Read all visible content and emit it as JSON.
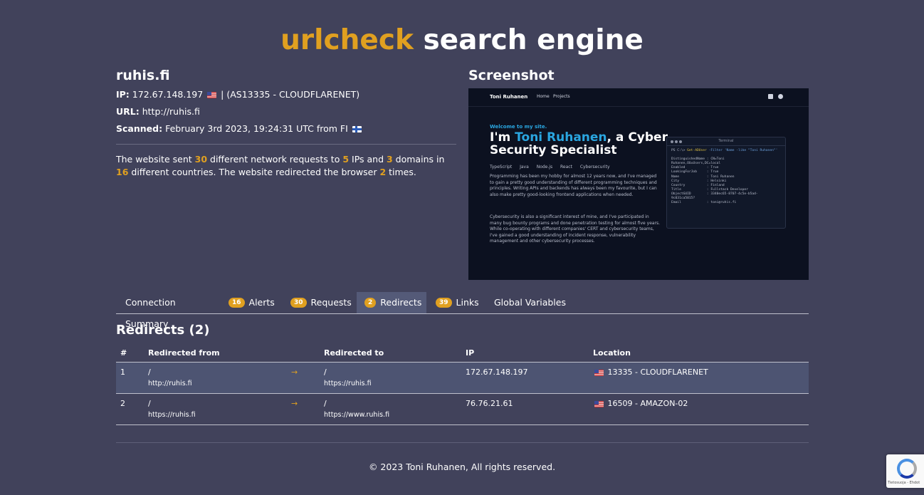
{
  "header": {
    "brand": "urlcheck",
    "rest": "search engine"
  },
  "site": {
    "domain": "ruhis.fi",
    "ip_label": "IP:",
    "ip": "172.67.148.197",
    "asn": "| (AS13335 - CLOUDFLARENET)",
    "url_label": "URL:",
    "url": "http://ruhis.fi",
    "scanned_label": "Scanned:",
    "scanned": "February 3rd 2023, 19:24:31 UTC from FI"
  },
  "summary": {
    "t1": "The website sent ",
    "requests": "30",
    "t2": " different network requests to ",
    "ips": "5",
    "t3": " IPs and ",
    "domains": "3",
    "t4": " domains in ",
    "countries": "16",
    "t5": " different countries. The website redirected the browser ",
    "redirects": "2",
    "t6": " times."
  },
  "screenshot": {
    "title": "Screenshot",
    "nav_name": "Toni Ruhanen",
    "nav_home": "Home",
    "nav_projects": "Projects",
    "welcome": "Welcome to my site.",
    "h1_a": "I'm ",
    "h1_name": "Toni Ruhanen",
    "h1_b": ", a Cyber Security Specialist",
    "tags": [
      "TypeScript",
      "Java",
      "Node.js",
      "React",
      "Cybersecurity"
    ],
    "p1": "Programming has been my hobby for almost 12 years now, and I've managed to gain a pretty good understanding of different programming techniques and principles. Writing APIs and backends has always been my favourite, but I can also make pretty good-looking frontend applications when needed.",
    "p2": "Cybersecurity is also a significant interest of mine, and I've participated in many bug bounty programs and done penetration testing for almost five years. While co-operating with different companies' CERT and cybersecurity teams, I've gained a good understanding of incident response, vulnerability management and other cybersecurity processes.",
    "terminal_title": "Terminal",
    "terminal_prompt": "PS C:\\> ",
    "terminal_cmd": "Get-ADUser",
    "terminal_args": " -Filter 'Name -like \"Toni Ruhanen\"'",
    "terminal_output": "DistinguishedName : CN=Toni\nRuhanen,OU=Users,DC=local\nEnabled           : True\nLookingForJob     : True\nName              : Toni Ruhanen\nCity              : Helsinki\nCountry           : Finland\nTitle             : Fullstack Developer\nObjectGUID        : 3340ec65-8707-4c5e-b5ad-\n9c031ca5015?\nEmail             : toni@ruhis.fi"
  },
  "tabs": [
    {
      "label": "Connection Summary",
      "badge": ""
    },
    {
      "label": "Alerts",
      "badge": "16"
    },
    {
      "label": "Requests",
      "badge": "30"
    },
    {
      "label": "Redirects",
      "badge": "2"
    },
    {
      "label": "Links",
      "badge": "39"
    },
    {
      "label": "Global Variables",
      "badge": ""
    }
  ],
  "redirects": {
    "title": "Redirects (2)",
    "headers": {
      "num": "#",
      "from": "Redirected from",
      "to": "Redirected to",
      "ip": "IP",
      "location": "Location"
    },
    "rows": [
      {
        "num": "1",
        "from_path": "/",
        "from_url": "http://ruhis.fi",
        "arrow": "→",
        "to_path": "/",
        "to_url": "https://ruhis.fi",
        "ip": "172.67.148.197",
        "location": "13335 - CLOUDFLARENET"
      },
      {
        "num": "2",
        "from_path": "/",
        "from_url": "https://ruhis.fi",
        "arrow": "→",
        "to_path": "/",
        "to_url": "https://www.ruhis.fi",
        "ip": "76.76.21.61",
        "location": "16509 - AMAZON-02"
      }
    ]
  },
  "footer": "© 2023 Toni Ruhanen, All rights reserved.",
  "recaptcha": {
    "text": "Tietosuoja - Ehdot"
  },
  "colors": {
    "background": "#41425b",
    "accent": "#e0a020",
    "active_tab": "#545a78",
    "row_highlight": "#4d5472"
  }
}
